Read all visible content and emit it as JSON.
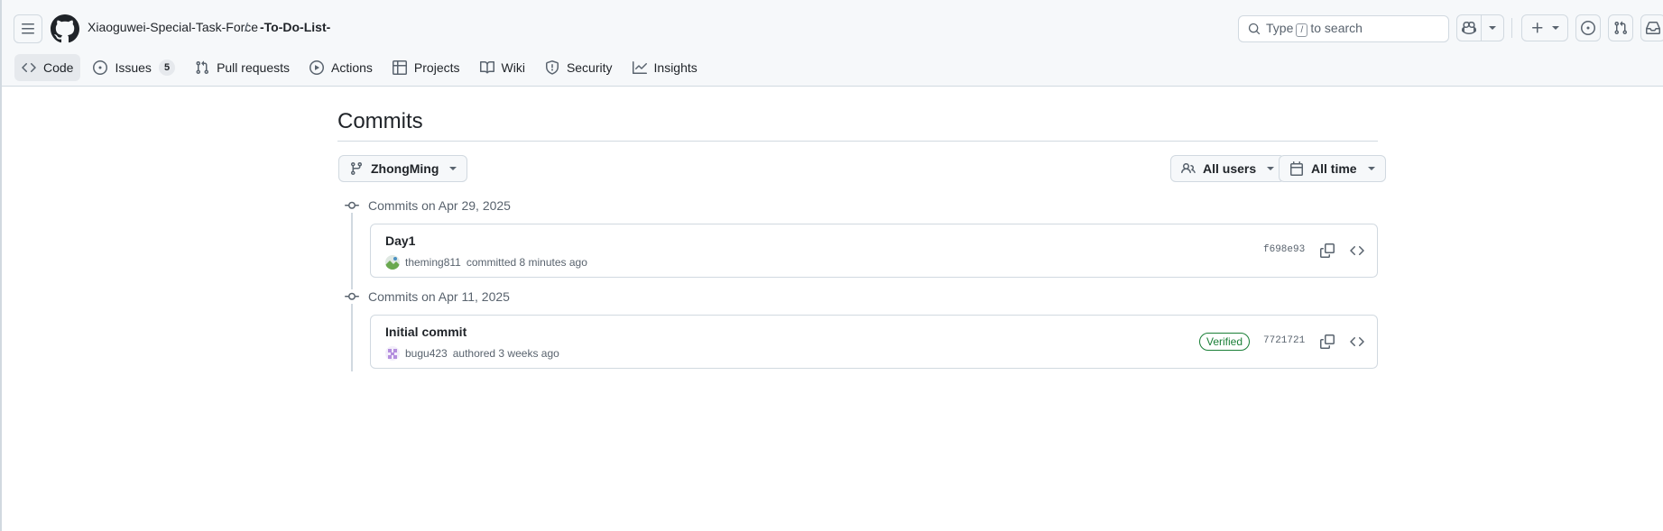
{
  "header": {
    "owner": "Xiaoguwei-Special-Task-Force",
    "separator": "/",
    "repo": "-To-Do-List-",
    "search_prefix": "Type",
    "search_key": "/",
    "search_suffix": "to search"
  },
  "repo_nav": {
    "items": [
      {
        "label": "Code",
        "icon": "code-icon",
        "selected": true
      },
      {
        "label": "Issues",
        "icon": "issue-opened-icon",
        "count": "5"
      },
      {
        "label": "Pull requests",
        "icon": "git-pull-request-icon"
      },
      {
        "label": "Actions",
        "icon": "play-icon"
      },
      {
        "label": "Projects",
        "icon": "table-icon"
      },
      {
        "label": "Wiki",
        "icon": "book-icon"
      },
      {
        "label": "Security",
        "icon": "shield-icon"
      },
      {
        "label": "Insights",
        "icon": "graph-icon"
      }
    ]
  },
  "main": {
    "title": "Commits",
    "branch": "ZhongMing",
    "users_filter": "All users",
    "time_filter": "All time",
    "groups": [
      {
        "date_label": "Commits on Apr 29, 2025",
        "commits": [
          {
            "title": "Day1",
            "author": "theming811",
            "action": "committed 8 minutes ago",
            "sha": "f698e93",
            "verified": false
          }
        ]
      },
      {
        "date_label": "Commits on Apr 11, 2025",
        "commits": [
          {
            "title": "Initial commit",
            "author": "bugu423",
            "action": "authored 3 weeks ago",
            "sha": "7721721",
            "verified": true,
            "badge": "Verified"
          }
        ]
      }
    ]
  },
  "colors": {
    "header_bg": "#f6f8fa",
    "border": "#d1d9e0",
    "text": "#1f2328",
    "muted": "#59636e",
    "verified_green": "#1a7f37"
  }
}
